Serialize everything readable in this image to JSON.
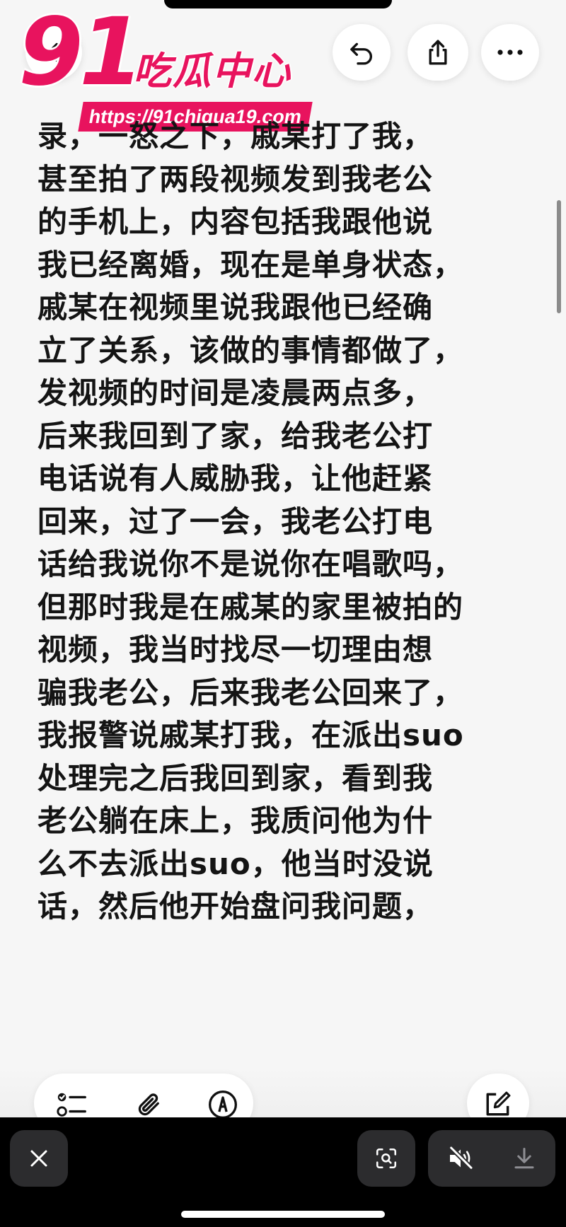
{
  "watermark": {
    "number": "91",
    "brand": "吃瓜中心",
    "url": "https://91chigua19.com"
  },
  "icons": {
    "back": "chevron-left-icon",
    "undo": "undo-icon",
    "share": "share-icon",
    "more": "more-icon",
    "checklist": "checklist-icon",
    "attach": "paperclip-icon",
    "markup": "markup-icon",
    "compose": "compose-icon",
    "close": "close-icon",
    "live_text": "live-text-icon",
    "mute": "speaker-muted-icon",
    "download": "download-icon"
  },
  "note": {
    "lines": [
      "录，一怒之下，戚某打了我，",
      "甚至拍了两段视频发到我老公",
      "的手机上，内容包括我跟他说",
      "我已经离婚，现在是单身状态，",
      "戚某在视频里说我跟他已经确",
      "立了关系，该做的事情都做了，",
      "发视频的时间是凌晨两点多，",
      "后来我回到了家，给我老公打",
      "电话说有人威胁我，让他赶紧",
      "回来，过了一会，我老公打电",
      "话给我说你不是说你在唱歌吗，",
      "但那时我是在戚某的家里被拍的",
      "视频，我当时找尽一切理由想",
      "骗我老公，后来我老公回来了，",
      "我报警说戚某打我，在派出suo",
      "处理完之后我回到家，看到我",
      "老公躺在床上，我质问他为什",
      "么不去派出suo，他当时没说",
      "话，然后他开始盘问我问题，"
    ]
  },
  "colors": {
    "brand_pink": "#e8135e",
    "background": "#f6f6f6",
    "bottom_bar": "#000000",
    "button_dark": "#2c2c2e"
  }
}
